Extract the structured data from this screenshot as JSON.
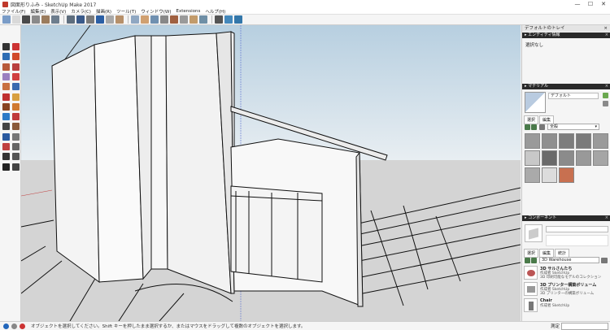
{
  "window": {
    "title": "図面形りふみ - SketchUp Make 2017",
    "controls": [
      "—",
      "☐",
      "✕"
    ]
  },
  "menu": [
    "ファイル(F)",
    "編集(E)",
    "表示(V)",
    "カメラ(C)",
    "描画(R)",
    "ツール(T)",
    "ウィンドウ(W)",
    "Extensions",
    "ヘルプ(H)"
  ],
  "toolbar": {
    "colors": [
      "#7a9cc7",
      "#d9d9d9",
      "#4a4a4a",
      "#8a8a8a",
      "#9b7c5d",
      "#6d7d8d",
      "#5d6d7d",
      "#3a5a8a",
      "#7a7a7a",
      "#2b5fa5",
      "#a8a8a8",
      "#b6906a",
      "#8fa7c2",
      "#d0a070",
      "#7090b0",
      "#888888",
      "#a06040",
      "#9a9a9a",
      "#c29b6b",
      "#6f8fa6",
      "#555555",
      "#4488bb",
      "#3377aa"
    ],
    "iconNames": [
      "iso-view-icon",
      "top-view-icon",
      "front-view-icon",
      "right-view-icon",
      "back-view-icon",
      "left-view-icon",
      "xray-icon",
      "wireframe-icon",
      "hidden-line-icon",
      "shaded-icon",
      "textured-icon",
      "monochrome-icon",
      "ruby-console-icon",
      "warehouse-icon",
      "share-model-icon",
      "component-icon",
      "extension-warehouse-icon",
      "layout-icon",
      "photo-icon",
      "materials-icon",
      "section-plane-icon",
      "section-display-icon",
      "section-fill-icon"
    ]
  },
  "leftTools": {
    "colors": [
      "#333333",
      "#cc3333",
      "#2e6db4",
      "#d14a2a",
      "#b85a3a",
      "#b94040",
      "#9a7fc0",
      "#d04040",
      "#c87040",
      "#3a6ab0",
      "#c03030",
      "#d8a040",
      "#884422",
      "#d07a30",
      "#2b7ac7",
      "#c03a3a",
      "#444444",
      "#8a5a3a",
      "#2a5aa0",
      "#777777",
      "#c04040",
      "#666666",
      "#333333",
      "#555555",
      "#222222",
      "#444444"
    ],
    "iconNames": [
      "select-icon",
      "eraser-icon",
      "paint-bucket-icon",
      "line-icon",
      "rectangle-icon",
      "rotated-rectangle-icon",
      "circle-icon",
      "polygon-icon",
      "arc-icon",
      "pie-icon",
      "push-pull-icon",
      "move-icon",
      "rotate-icon",
      "scale-icon",
      "follow-me-icon",
      "offset-icon",
      "tape-measure-icon",
      "dimension-icon",
      "protractor-icon",
      "text-icon",
      "axes-icon",
      "3d-text-icon",
      "orbit-icon",
      "pan-icon",
      "zoom-icon",
      "zoom-extents-icon"
    ]
  },
  "tray": {
    "title": "デフォルトのトレイ",
    "close": "×",
    "entity": {
      "header": "▸ エンティティ情報",
      "close": "×",
      "content": "選択なし"
    },
    "materials": {
      "header": "▸ マテリアル",
      "close": "×",
      "name": "デフォルト",
      "tabs": [
        "選択",
        "編集"
      ],
      "dropdown": "全般",
      "dropdownArrow": "▾",
      "swatches": [
        "#9a9a9a",
        "#8f8f8f",
        "#7d7d7d",
        "#7a7a7a",
        "#9a9a9a",
        "#c8c8c8",
        "#6a6a6a",
        "#8b8b8b",
        "#999999",
        "#a5a5a5",
        "#aaaaaa",
        "#dcdcdc",
        "#c87050"
      ]
    },
    "components": {
      "header": "▸ コンポーネント",
      "close": "×",
      "tabs": [
        "選択",
        "編集",
        "統計"
      ],
      "search": "3D Warehouse",
      "items": [
        {
          "title": "3D サルさんたち",
          "author": "作成者 SketchUp",
          "desc": "3D 印刷可能なモデルのコレクション"
        },
        {
          "title": "3D プリンター構築ボリューム",
          "author": "作成者 SketchUp",
          "desc": "3D プリンターの構築ボリューム"
        },
        {
          "title": "Chair",
          "author": "作成者 SketchUp",
          "desc": ""
        }
      ]
    }
  },
  "status": {
    "message": "オブジェクトを選択してください。Shift キーを押したまま選択するか、またはマウスをドラッグして複数のオブジェクトを選択します。",
    "measurementsLabel": "測定",
    "icons": [
      "#2266bb",
      "#888888",
      "#cc3333"
    ]
  }
}
